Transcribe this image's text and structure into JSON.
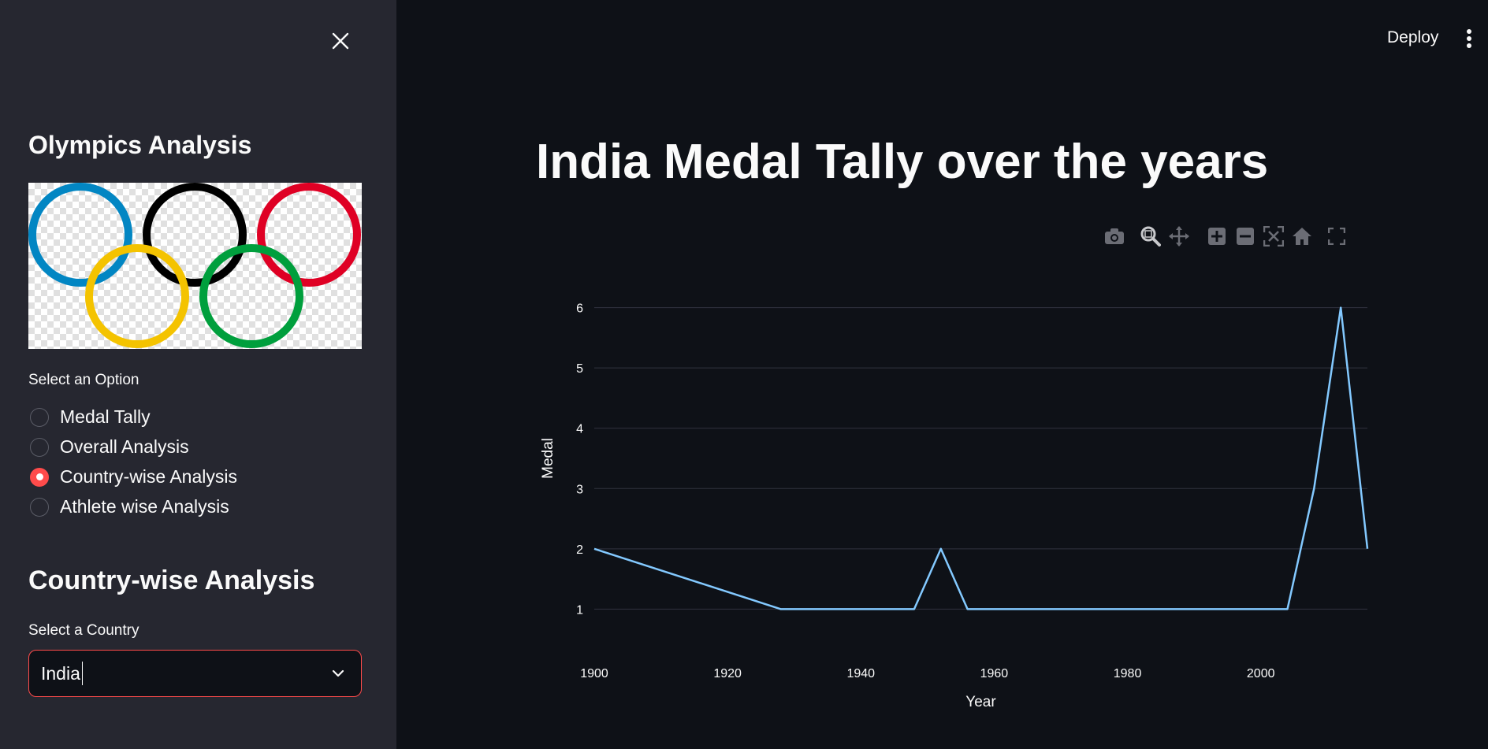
{
  "sidebar": {
    "title": "Olympics Analysis",
    "radio_label": "Select an Option",
    "options": [
      {
        "label": "Medal Tally",
        "selected": false
      },
      {
        "label": "Overall Analysis",
        "selected": false
      },
      {
        "label": "Country-wise Analysis",
        "selected": true
      },
      {
        "label": "Athlete wise Analysis",
        "selected": false
      }
    ],
    "section_title": "Country-wise Analysis",
    "select_label": "Select a Country",
    "select_value": "India"
  },
  "header": {
    "deploy_label": "Deploy"
  },
  "main": {
    "title": "India Medal Tally over the years"
  },
  "modebar_icons": [
    "camera-icon",
    "zoom-icon",
    "pan-icon",
    "zoom-in-icon",
    "zoom-out-icon",
    "autoscale-icon",
    "reset-axes-icon",
    "fullscreen-icon"
  ],
  "colors": {
    "accent": "#ff4b4b",
    "line": "#83c9ff",
    "sidebar_bg": "#262730",
    "main_bg": "#0e1117"
  },
  "chart_data": {
    "type": "line",
    "xlabel": "Year",
    "ylabel": "Medal",
    "xlim": [
      1900,
      2016
    ],
    "ylim": [
      0.6,
      6.4
    ],
    "x_ticks": [
      1900,
      1920,
      1940,
      1960,
      1980,
      2000
    ],
    "y_ticks": [
      1,
      2,
      3,
      4,
      5,
      6
    ],
    "grid": true,
    "series": [
      {
        "x": [
          1900,
          1928,
          1948,
          1952,
          1956,
          2004,
          2008,
          2012,
          2016
        ],
        "y": [
          2,
          1,
          1,
          2,
          1,
          1,
          3,
          6,
          2
        ]
      }
    ]
  }
}
